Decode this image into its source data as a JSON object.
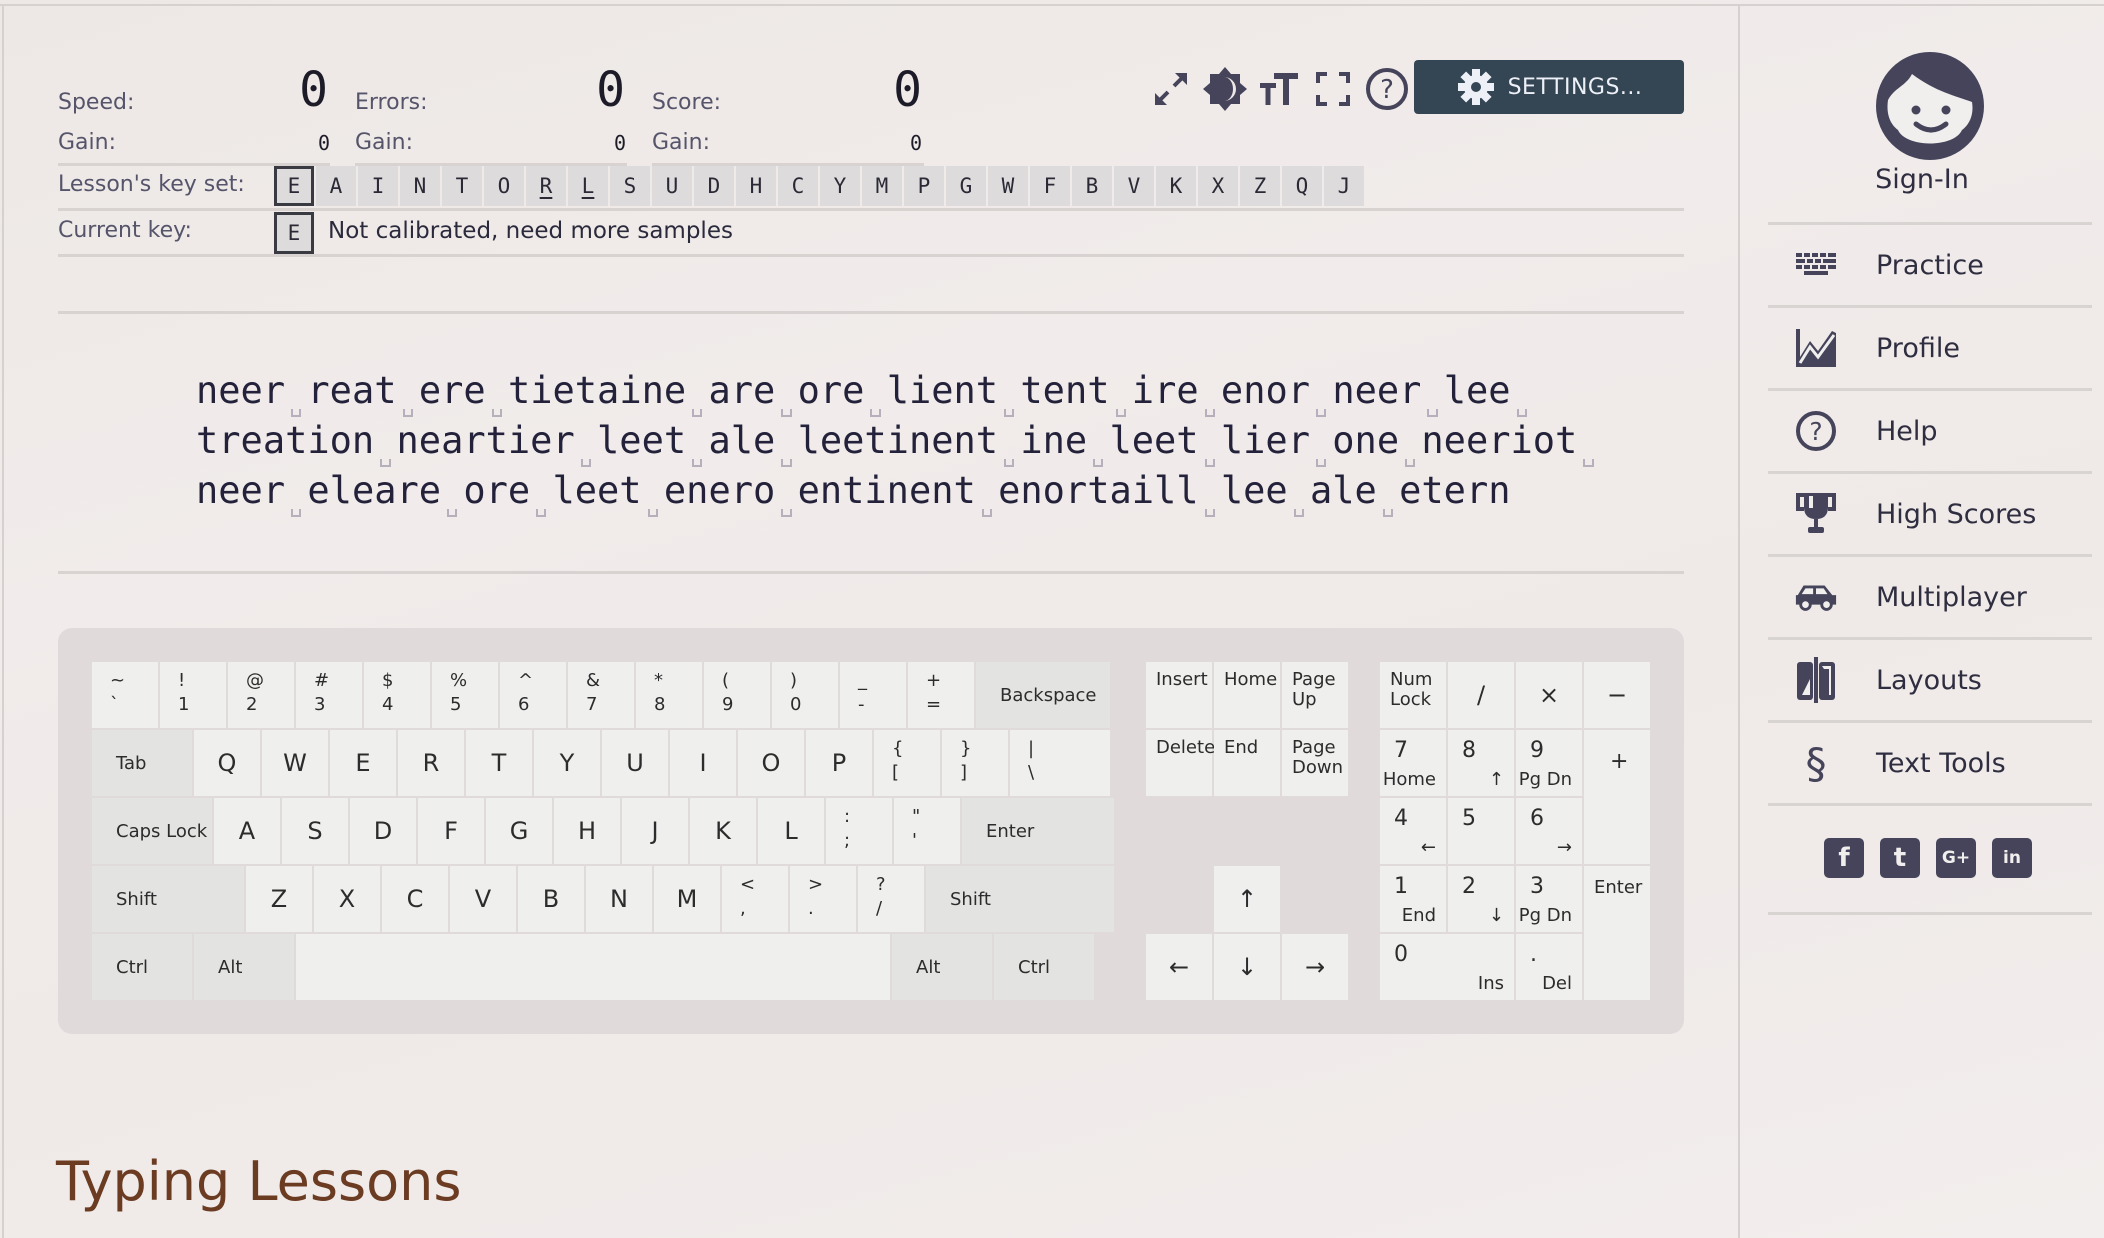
{
  "stats": {
    "speed": {
      "label": "Speed:",
      "value": "0",
      "gain_label": "Gain:",
      "gain": "0"
    },
    "errors": {
      "label": "Errors:",
      "value": "0",
      "gain_label": "Gain:",
      "gain": "0"
    },
    "score": {
      "label": "Score:",
      "value": "0",
      "gain_label": "Gain:",
      "gain": "0"
    }
  },
  "toolbar": {
    "icons": [
      "expand-icon",
      "theme-toggle-icon",
      "font-size-icon",
      "fullscreen-icon",
      "help-icon"
    ],
    "settings_label": "SETTINGS..."
  },
  "keyset": {
    "label": "Lesson's key set:",
    "keys": [
      "E",
      "A",
      "I",
      "N",
      "T",
      "O",
      "R",
      "L",
      "S",
      "U",
      "D",
      "H",
      "C",
      "Y",
      "M",
      "P",
      "G",
      "W",
      "F",
      "B",
      "V",
      "K",
      "X",
      "Z",
      "Q",
      "J"
    ],
    "current_index": 0,
    "underlined": [
      "R",
      "L"
    ]
  },
  "current_key": {
    "label": "Current key:",
    "key": "E",
    "status": "Not calibrated, need more samples"
  },
  "lesson_text": {
    "lines": [
      "neer reat ere tietaine are ore lient tent ire enor neer lee ",
      "treation neartier leet ale leetinent ine leet lier one neeriot ",
      "neer eleare ore leet enero entinent enortaill lee ale etern"
    ]
  },
  "keyboard": {
    "rows": [
      [
        {
          "top": "~",
          "bot": "`"
        },
        {
          "top": "!",
          "bot": "1"
        },
        {
          "top": "@",
          "bot": "2"
        },
        {
          "top": "#",
          "bot": "3"
        },
        {
          "top": "$",
          "bot": "4"
        },
        {
          "top": "%",
          "bot": "5"
        },
        {
          "top": "^",
          "bot": "6"
        },
        {
          "top": "&",
          "bot": "7"
        },
        {
          "top": "*",
          "bot": "8"
        },
        {
          "top": "(",
          "bot": "9"
        },
        {
          "top": ")",
          "bot": "0"
        },
        {
          "top": "_",
          "bot": "-"
        },
        {
          "top": "+",
          "bot": "="
        },
        {
          "label": "Backspace",
          "mod": true
        }
      ],
      [
        {
          "label": "Tab",
          "mod": true
        },
        {
          "c": "Q"
        },
        {
          "c": "W"
        },
        {
          "c": "E"
        },
        {
          "c": "R"
        },
        {
          "c": "T"
        },
        {
          "c": "Y"
        },
        {
          "c": "U"
        },
        {
          "c": "I"
        },
        {
          "c": "O"
        },
        {
          "c": "P"
        },
        {
          "top": "{",
          "bot": "["
        },
        {
          "top": "}",
          "bot": "]"
        },
        {
          "top": "|",
          "bot": "\\"
        }
      ],
      [
        {
          "label": "Caps Lock",
          "mod": true
        },
        {
          "c": "A"
        },
        {
          "c": "S"
        },
        {
          "c": "D"
        },
        {
          "c": "F"
        },
        {
          "c": "G"
        },
        {
          "c": "H"
        },
        {
          "c": "J"
        },
        {
          "c": "K"
        },
        {
          "c": "L"
        },
        {
          "top": ":",
          "bot": ";"
        },
        {
          "top": "\"",
          "bot": "'"
        },
        {
          "label": "Enter",
          "mod": true
        }
      ],
      [
        {
          "label": "Shift",
          "mod": true
        },
        {
          "c": "Z"
        },
        {
          "c": "X"
        },
        {
          "c": "C"
        },
        {
          "c": "V"
        },
        {
          "c": "B"
        },
        {
          "c": "N"
        },
        {
          "c": "M"
        },
        {
          "top": "<",
          "bot": ","
        },
        {
          "top": ">",
          "bot": "."
        },
        {
          "top": "?",
          "bot": "/"
        },
        {
          "label": "Shift",
          "mod": true
        }
      ],
      [
        {
          "label": "Ctrl",
          "mod": true
        },
        {
          "label": "Alt",
          "mod": true
        },
        {
          "label": ""
        },
        {
          "label": "Alt",
          "mod": true
        },
        {
          "label": "Ctrl",
          "mod": true
        }
      ]
    ],
    "nav": {
      "insert": "Insert",
      "home": "Home",
      "page_up": "Page Up",
      "delete": "Delete",
      "end": "End",
      "page_down": "Page Down",
      "up": "↑",
      "left": "←",
      "down": "↓",
      "right": "→"
    },
    "numpad": {
      "num_lock": "Num Lock",
      "divide": "/",
      "multiply": "×",
      "minus": "−",
      "plus": "+",
      "enter": "Enter",
      "k7": {
        "num": "7",
        "sub": "Home"
      },
      "k8": {
        "num": "8",
        "sub": "↑"
      },
      "k9": {
        "num": "9",
        "sub": "Pg Dn"
      },
      "k4": {
        "num": "4",
        "sub": "←"
      },
      "k5": {
        "num": "5",
        "sub": ""
      },
      "k6": {
        "num": "6",
        "sub": "→"
      },
      "k1": {
        "num": "1",
        "sub": "End"
      },
      "k2": {
        "num": "2",
        "sub": "↓"
      },
      "k3": {
        "num": "3",
        "sub": "Pg Dn"
      },
      "k0": {
        "num": "0",
        "sub": "Ins"
      },
      "kdot": {
        "num": ".",
        "sub": "Del"
      }
    }
  },
  "sidebar": {
    "signin": "Sign-In",
    "items": [
      {
        "label": "Practice",
        "icon": "keyboard-icon"
      },
      {
        "label": "Profile",
        "icon": "chart-icon"
      },
      {
        "label": "Help",
        "icon": "help-circle-icon"
      },
      {
        "label": "High Scores",
        "icon": "trophy-icon"
      },
      {
        "label": "Multiplayer",
        "icon": "car-icon"
      },
      {
        "label": "Layouts",
        "icon": "layouts-icon"
      },
      {
        "label": "Text Tools",
        "icon": "section-sign-icon"
      }
    ],
    "social": [
      {
        "name": "facebook-icon",
        "glyph": "f"
      },
      {
        "name": "twitter-icon",
        "glyph": "t"
      },
      {
        "name": "google-plus-icon",
        "glyph": "G+"
      },
      {
        "name": "linkedin-icon",
        "glyph": "in"
      }
    ]
  },
  "section_title": "Typing Lessons",
  "colors": {
    "settings_bg": "#344554",
    "icon": "#45445a",
    "title": "#6b3b22"
  }
}
